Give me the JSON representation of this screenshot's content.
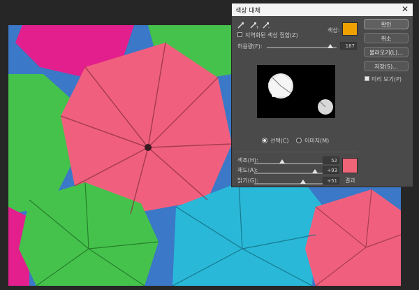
{
  "colors": {
    "sample_color": "#f0a000",
    "result_color": "#f06478",
    "umbrella_pink": "#f0607e",
    "umbrella_green": "#45c24c",
    "umbrella_cyan": "#29b8d8",
    "umbrella_magenta": "#e21f8c",
    "sky_blue": "#3b78c7"
  },
  "dialog": {
    "title": "색상 대체",
    "close_glyph": "✕",
    "eyedropper_icons": [
      "eyedropper-icon",
      "eyedropper-plus-icon",
      "eyedropper-minus-icon"
    ],
    "localized_clusters_label": "지역화된 색상 집합(Z)",
    "color_label": "색상:",
    "fuzziness_label": "허용량(F):",
    "fuzziness_value": "187",
    "selection_label": "선택(C)",
    "image_label": "이미지(M)",
    "selection_mode": "selection",
    "hue_label": "색조(H):",
    "hue_value": "52",
    "saturation_label": "채도(A):",
    "saturation_value": "+93",
    "lightness_label": "밝기(G):",
    "lightness_value": "+51",
    "result_label": "결과",
    "buttons": {
      "ok": "확인",
      "cancel": "취소",
      "load": "불러오기(L)...",
      "save": "저장(S)...",
      "preview": "미리 보기(P)"
    },
    "preview_checked": true,
    "localized_checked": false
  }
}
